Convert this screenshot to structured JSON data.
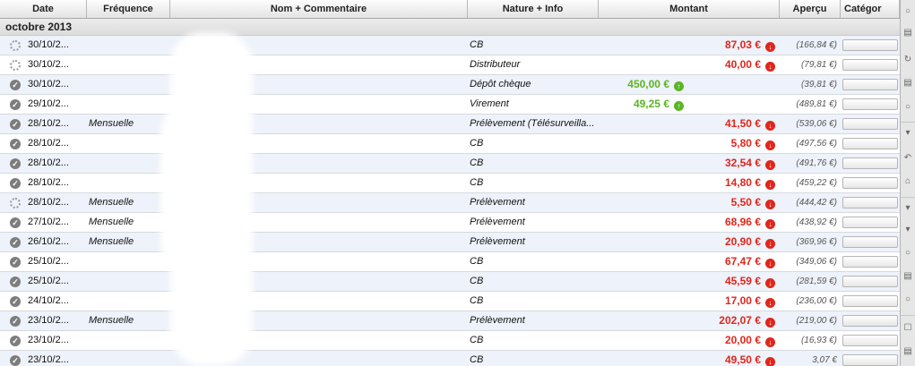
{
  "columns": {
    "date": "Date",
    "frequence": "Fréquence",
    "nom": "Nom + Commentaire",
    "nature": "Nature + Info",
    "montant": "Montant",
    "apercu": "Aperçu",
    "categorie": "Catégor"
  },
  "group_label": "octobre 2013",
  "colors": {
    "debit": "#e0261b",
    "credit": "#5bb523",
    "alt_row": "#eef2fa"
  },
  "rows": [
    {
      "status": "pending",
      "date": "30/10/2...",
      "freq": "",
      "nature": "CB",
      "amount": "87,03 €",
      "type": "debit",
      "apercu": "(166,84 €)"
    },
    {
      "status": "pending",
      "date": "30/10/2...",
      "freq": "",
      "nature": "Distributeur",
      "amount": "40,00 €",
      "type": "debit",
      "apercu": "(79,81 €)"
    },
    {
      "status": "ok",
      "date": "30/10/2...",
      "freq": "",
      "nature": "Dépôt chèque",
      "amount": "450,00 €",
      "type": "credit",
      "apercu": "(39,81 €)"
    },
    {
      "status": "ok",
      "date": "29/10/2...",
      "freq": "",
      "nature": "Virement",
      "amount": "49,25 €",
      "type": "credit",
      "apercu": "(489,81 €)"
    },
    {
      "status": "ok",
      "date": "28/10/2...",
      "freq": "Mensuelle",
      "nature": "Prélèvement (Télésurveilla...",
      "amount": "41,50 €",
      "type": "debit",
      "apercu": "(539,06 €)"
    },
    {
      "status": "ok",
      "date": "28/10/2...",
      "freq": "",
      "nature": "CB",
      "amount": "5,80 €",
      "type": "debit",
      "apercu": "(497,56 €)"
    },
    {
      "status": "ok",
      "date": "28/10/2...",
      "freq": "",
      "nature": "CB",
      "amount": "32,54 €",
      "type": "debit",
      "apercu": "(491,76 €)"
    },
    {
      "status": "ok",
      "date": "28/10/2...",
      "freq": "",
      "nature": "CB",
      "amount": "14,80 €",
      "type": "debit",
      "apercu": "(459,22 €)"
    },
    {
      "status": "pending",
      "date": "28/10/2...",
      "freq": "Mensuelle",
      "nature": "Prélèvement",
      "amount": "5,50 €",
      "type": "debit",
      "apercu": "(444,42 €)"
    },
    {
      "status": "ok",
      "date": "27/10/2...",
      "freq": "Mensuelle",
      "nature": "Prélèvement",
      "amount": "68,96 €",
      "type": "debit",
      "apercu": "(438,92 €)"
    },
    {
      "status": "ok",
      "date": "26/10/2...",
      "freq": "Mensuelle",
      "nature": "Prélèvement",
      "amount": "20,90 €",
      "type": "debit",
      "apercu": "(369,96 €)"
    },
    {
      "status": "ok",
      "date": "25/10/2...",
      "freq": "",
      "nature": "CB",
      "amount": "67,47 €",
      "type": "debit",
      "apercu": "(349,06 €)"
    },
    {
      "status": "ok",
      "date": "25/10/2...",
      "freq": "",
      "nature": "CB",
      "amount": "45,59 €",
      "type": "debit",
      "apercu": "(281,59 €)"
    },
    {
      "status": "ok",
      "date": "24/10/2...",
      "freq": "",
      "nature": "CB",
      "amount": "17,00 €",
      "type": "debit",
      "apercu": "(236,00 €)"
    },
    {
      "status": "ok",
      "date": "23/10/2...",
      "freq": "Mensuelle",
      "nature": "Prélèvement",
      "amount": "202,07 €",
      "type": "debit",
      "apercu": "(219,00 €)"
    },
    {
      "status": "ok",
      "date": "23/10/2...",
      "freq": "",
      "nature": "CB",
      "amount": "20,00 €",
      "type": "debit",
      "apercu": "(16,93 €)"
    },
    {
      "status": "ok",
      "date": "23/10/2...",
      "freq": "",
      "nature": "CB",
      "amount": "49,50 €",
      "type": "debit",
      "apercu": "3,07 €"
    }
  ]
}
